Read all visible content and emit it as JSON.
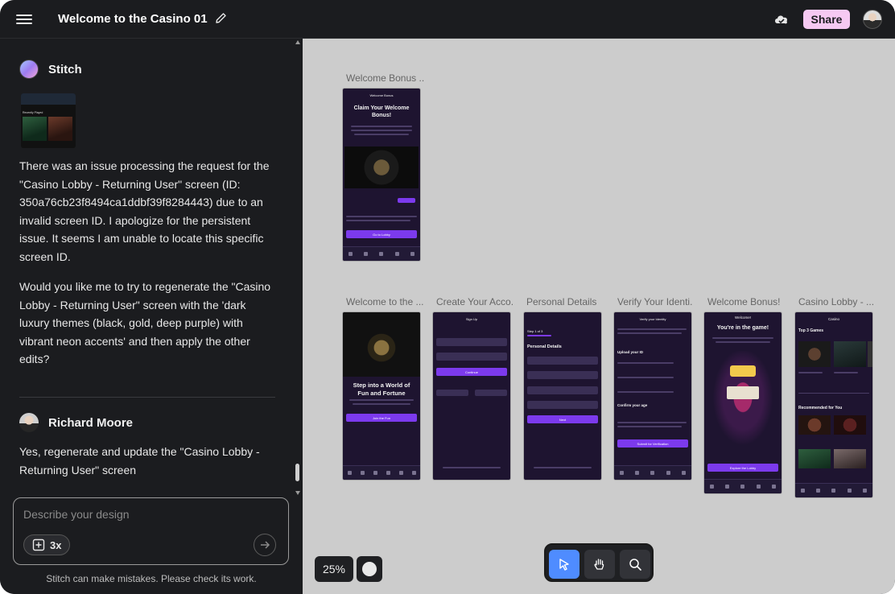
{
  "topbar": {
    "title": "Welcome to the Casino 01",
    "share_label": "Share"
  },
  "chat": {
    "stitch_author": "Stitch",
    "stitch_message_1": "There was an issue processing the request for the \"Casino Lobby - Returning User\" screen (ID: 350a76cb23f8494ca1ddbf39f8284443) due to an invalid screen ID. I apologize for the persistent issue. It seems I am unable to locate this specific screen ID.",
    "stitch_message_2": "Would you like me to try to regenerate the \"Casino Lobby - Returning User\" screen with the 'dark luxury themes (black, gold, deep purple) with vibrant neon accents' and then apply the other edits?",
    "user_author": "Richard Moore",
    "user_message": "Yes, regenerate and update the \"Casino Lobby - Returning User\" screen",
    "thumbnail": {
      "caption": "Recently Played"
    }
  },
  "composer": {
    "placeholder": "Describe your design",
    "boost_label": "3x"
  },
  "disclaimer": "Stitch can make mistakes. Please check its work.",
  "canvas": {
    "zoom": "25%",
    "frames": [
      {
        "label": "Welcome Bonus ...",
        "header": "Welcome Bonus",
        "heading": "Claim Your Welcome Bonus!",
        "button": "Go to Lobby"
      },
      {
        "label": "Welcome to the ...",
        "heading": "Step into a World of Fun and Fortune",
        "button": "Join the Fun"
      },
      {
        "label": "Create Your Acco...",
        "header": "Sign Up",
        "button": "Continue"
      },
      {
        "label": "Personal Details",
        "header": "Step 1 of 3",
        "heading": "Personal Details",
        "button": "Next"
      },
      {
        "label": "Verify Your Identi...",
        "header": "Verify your Identity",
        "heading": "Upload your ID",
        "subheading": "Confirm your age",
        "button": "Submit for Verification"
      },
      {
        "label": "Welcome Bonus!",
        "header": "Welcome!",
        "heading": "You're in the game!",
        "button": "Explore the Lobby"
      },
      {
        "label": "Casino Lobby - ...",
        "header": "Casino",
        "heading": "Top 3 Games",
        "subheading": "Recommended for You"
      }
    ]
  }
}
